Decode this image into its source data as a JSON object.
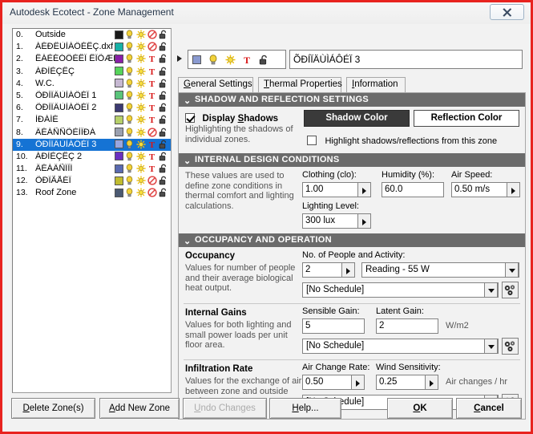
{
  "window": {
    "title": "Autodesk Ecotect - Zone Management",
    "close_label": "✕"
  },
  "zone_list": {
    "rows": [
      {
        "index": "0.",
        "label": "Outside",
        "color": "#1a1a1a",
        "third_icon": "prohibition-icon",
        "selected": false
      },
      {
        "index": "1.",
        "label": "ÁÉÐËÙÌÁÔÉÊÇ.dxf",
        "color": "#18b2a8",
        "third_icon": "prohibition-icon",
        "selected": false
      },
      {
        "index": "2.",
        "label": "ÊÁÈÉÓÔÉÊÏ ÊÏÕÆÉ",
        "color": "#8a1fa8",
        "third_icon": "thermostat-icon",
        "selected": false
      },
      {
        "index": "3.",
        "label": "ÁÐÌÈÇÊÇ",
        "color": "#56d45b",
        "third_icon": "thermostat-icon",
        "selected": false
      },
      {
        "index": "4.",
        "label": "W.C.",
        "color": "#c6b8d2",
        "third_icon": "thermostat-icon",
        "selected": false
      },
      {
        "index": "5.",
        "label": "ÕÐÍÏÄÙÌÁÔÉÏ 1",
        "color": "#5ac47a",
        "third_icon": "thermostat-icon",
        "selected": false
      },
      {
        "index": "6.",
        "label": "ÕÐÍÏÄÙÌÁÔÉÏ 2",
        "color": "#3c3a72",
        "third_icon": "thermostat-icon",
        "selected": false
      },
      {
        "index": "7.",
        "label": "ÌÐÁÍÉ",
        "color": "#b6d06a",
        "third_icon": "thermostat-icon",
        "selected": false
      },
      {
        "index": "8.",
        "label": "ÄÉÁÑÑÕÈÌÏÐÁ",
        "color": "#9aa0b0",
        "third_icon": "prohibition-icon",
        "selected": false
      },
      {
        "index": "9.",
        "label": "ÕÐÍÏÄÙÌÁÔÉÏ 3",
        "color": "#9aa6e0",
        "third_icon": "thermostat-icon",
        "selected": true
      },
      {
        "index": "10.",
        "label": "ÁÐÌÈÇÊÇ 2",
        "color": "#6a2fc0",
        "third_icon": "thermostat-icon",
        "selected": false
      },
      {
        "index": "11.",
        "label": "ÄÉÁÄÑÏÌÏ",
        "color": "#5a6ab0",
        "third_icon": "thermostat-icon",
        "selected": false
      },
      {
        "index": "12.",
        "label": "ÕÐÏÃÅÉÏ",
        "color": "#c0bc30",
        "third_icon": "prohibition-icon",
        "selected": false
      },
      {
        "index": "13.",
        "label": "Roof Zone",
        "color": "#4b5a72",
        "third_icon": "prohibition-icon",
        "selected": false
      }
    ]
  },
  "zone_header": {
    "swatch_color": "#8a9ad0",
    "name_value": "ÕÐÍÏÄÙÌÁÔÉÏ 3",
    "icons": [
      "color-swatch-icon",
      "lightbulb-icon",
      "sun-icon",
      "thermostat-icon",
      "unlock-icon"
    ]
  },
  "tabs": [
    {
      "label": "General Settings",
      "accel": "G",
      "active": true
    },
    {
      "label": "Thermal Properties",
      "accel": "T",
      "active": false
    },
    {
      "label": "Information",
      "accel": "I",
      "active": false
    }
  ],
  "shadow_section": {
    "header": "SHADOW AND REFLECTION SETTINGS",
    "display_shadows_label": "Display Shadows",
    "display_shadows_accel": "S",
    "display_shadows_checked": true,
    "description": "Highlighting the shadows of individual zones.",
    "shadow_color_button": "Shadow Color",
    "reflection_color_button": "Reflection Color",
    "highlight_label": "Highlight shadows/reflections from this zone",
    "highlight_checked": false
  },
  "internal_design": {
    "header": "INTERNAL DESIGN CONDITIONS",
    "description": "These values are used to define zone conditions in thermal comfort and lighting calculations.",
    "clothing_label": "Clothing (clo):",
    "clothing_value": "1.00",
    "humidity_label": "Humidity (%):",
    "humidity_value": "60.0",
    "airspeed_label": "Air Speed:",
    "airspeed_value": "0.50 m/s",
    "lighting_label": "Lighting Level:",
    "lighting_value": "300 lux"
  },
  "occupancy_section": {
    "header": "OCCUPANCY AND OPERATION",
    "occupancy": {
      "title": "Occupancy",
      "description": "Values for number of people and their average biological heat output.",
      "field_label": "No. of People and Activity:",
      "people_value": "2",
      "activity_value": "Reading  -  55 W",
      "schedule_value": "[No Schedule]"
    },
    "internal_gains": {
      "title": "Internal Gains",
      "description": "Values for both lighting and small power loads per unit floor area.",
      "sensible_label": "Sensible Gain:",
      "sensible_value": "5",
      "latent_label": "Latent Gain:",
      "latent_value": "2",
      "units": "W/m2",
      "schedule_value": "[No Schedule]"
    },
    "infiltration": {
      "title": "Infiltration Rate",
      "description": "Values for the exchange of air between zone and outside environment.",
      "acr_label": "Air Change Rate:",
      "acr_value": "0.50",
      "wind_label": "Wind Sensitivity:",
      "wind_value": "0.25",
      "units": "Air changes / hr",
      "schedule_value": "[No Schedule]"
    }
  },
  "bottom_buttons": [
    {
      "label": "Delete Zone(s)",
      "accel": "D",
      "disabled": false,
      "bold": false
    },
    {
      "label": "Add New Zone",
      "accel": "A",
      "disabled": false,
      "bold": false
    },
    {
      "label": "Undo Changes",
      "accel": "U",
      "disabled": true,
      "bold": false
    },
    {
      "label": "Help...",
      "accel": "H",
      "disabled": false,
      "bold": false
    },
    {
      "label": "OK",
      "accel": "O",
      "disabled": false,
      "bold": true
    },
    {
      "label": "Cancel",
      "accel": "C",
      "disabled": false,
      "bold": true
    }
  ],
  "colors": {
    "selection_blue": "#1573d4",
    "section_header_gray": "#6b6b6b",
    "frame_red": "#e8231f",
    "shadow_button_dark": "#3a3a3a"
  }
}
